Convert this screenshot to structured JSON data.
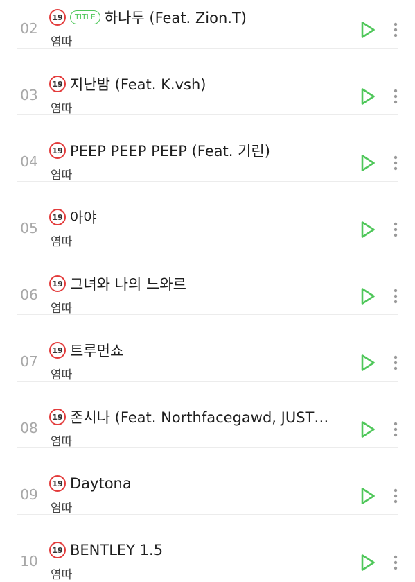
{
  "tracks": [
    {
      "number": "02",
      "age_badge": "19",
      "title_badge": "TITLE",
      "title": "하나두 (Feat. Zion.T)",
      "artist": "염따"
    },
    {
      "number": "03",
      "age_badge": "19",
      "title_badge": "",
      "title": "지난밤 (Feat. K.vsh)",
      "artist": "염따"
    },
    {
      "number": "04",
      "age_badge": "19",
      "title_badge": "",
      "title": "PEEP PEEP PEEP (Feat. 기린)",
      "artist": "염따"
    },
    {
      "number": "05",
      "age_badge": "19",
      "title_badge": "",
      "title": "아야",
      "artist": "염따"
    },
    {
      "number": "06",
      "age_badge": "19",
      "title_badge": "",
      "title": "그녀와 나의 느와르",
      "artist": "염따"
    },
    {
      "number": "07",
      "age_badge": "19",
      "title_badge": "",
      "title": "트루먼쇼",
      "artist": "염따"
    },
    {
      "number": "08",
      "age_badge": "19",
      "title_badge": "",
      "title": "존시나 (Feat. Northfacegawd, JUST…",
      "artist": "염따"
    },
    {
      "number": "09",
      "age_badge": "19",
      "title_badge": "",
      "title": "Daytona",
      "artist": "염따"
    },
    {
      "number": "10",
      "age_badge": "19",
      "title_badge": "",
      "title": "BENTLEY 1.5",
      "artist": "염따"
    }
  ],
  "colors": {
    "accent_green": "#4fc75a",
    "age_badge_red": "#e33b3b",
    "more_gray": "#9a9a9a"
  },
  "icons": {
    "play": "play-icon",
    "more": "more-vertical-icon"
  }
}
